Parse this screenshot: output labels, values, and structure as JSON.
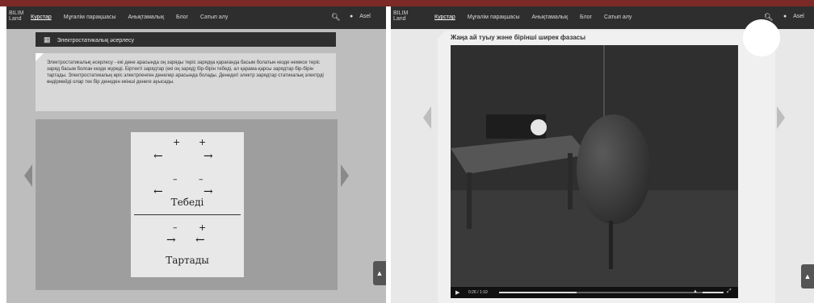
{
  "left": {
    "nav": {
      "logo": "BILIM Land",
      "items": [
        "Курстар",
        "Мұғалім парақшасы",
        "Анықтамалық",
        "Блог",
        "Сатып алу"
      ],
      "user": "Asel"
    },
    "section_title": "Электростатикалық әсерлесу",
    "paragraph": "Электростатикалық әсерлесу - екі дене арасында оң заряды теріс зарядқа қарағанда басым болатын кезде немесе теріс заряд басым болған кезде жүреді. Біртекті зарядтар (екі оң заряд) бір-бірін тебеді, ал қарама-қарсы зарядтар бір-бірін тартады. Электростатикалық өріс электрленген денелер арасында болады. Денедегі электр зарядтар статикалық электрді өндірмейді олар тек бір денеден екінші денеге ауысады.",
    "diagram": {
      "repel_label": "Тебеді",
      "attract_label": "Тартады",
      "plus": "+",
      "minus": "–"
    }
  },
  "right": {
    "nav": {
      "logo": "BILIM Land",
      "items": [
        "Курстар",
        "Мұғалім парақшасы",
        "Анықтамалық",
        "Блог",
        "Сатып алу"
      ],
      "user": "Asel"
    },
    "video_title": "Жаңа ай туыу және бірінші ширек фазасы",
    "video_time": "0:26 / 1:10"
  },
  "icons": {
    "search": "search-icon",
    "user": "user-icon",
    "prev": "chevron-left-icon",
    "next": "chevron-right-icon",
    "scroll_top": "arrow-up-icon"
  }
}
